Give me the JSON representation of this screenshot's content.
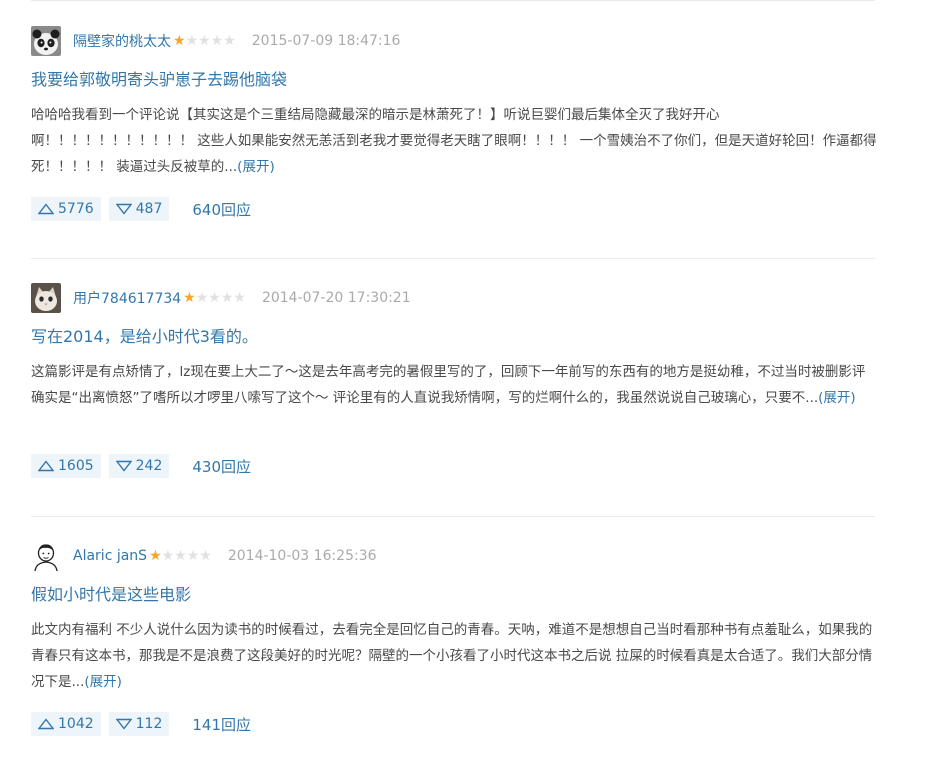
{
  "colors": {
    "link": "#3377aa",
    "text": "#494949",
    "muted": "#aaaaaa",
    "star_on": "#f6a623",
    "star_off": "#e1e1e1",
    "vote_bg": "#edf4fa"
  },
  "reviews": [
    {
      "author": "隔壁家的桃太太",
      "rating_stars": 1,
      "rating_max": 5,
      "time": "2015-07-09 18:47:16",
      "title": "我要给郭敬明寄头驴崽子去踢他脑袋",
      "excerpt": "哈哈哈我看到一个评论说【其实这是个三重结局隐藏最深的暗示是林萧死了！】听说巨婴们最后集体全灭了我好开心啊！！！！！！！！！！！ 这些人如果能安然无恙活到老我才要觉得老天瞎了眼啊！！！！ 一个雪姨治不了你们，但是天道好轮回！作逼都得死！！！！！ 装逼过头反被草的...",
      "expand_label": "(展开)",
      "up": "5776",
      "down": "487",
      "replies": "640回应",
      "avatar_icon": "panda-avatar-icon"
    },
    {
      "author": "用户784617734",
      "rating_stars": 1,
      "rating_max": 5,
      "time": "2014-07-20 17:30:21",
      "title": "写在2014，是给小时代3看的。",
      "excerpt": "这篇影评是有点矫情了，lz现在要上大二了～这是去年高考完的暑假里写的了，回顾下一年前写的东西有的地方是挺幼稚，不过当时被删影评确实是“出离愤怒”了嗜所以才啰里八嗦写了这个～ 评论里有的人直说我矫情啊，写的烂啊什么的，我虽然说说自己玻璃心，只要不...",
      "expand_label": "(展开)",
      "up": "1605",
      "down": "242",
      "replies": "430回应",
      "avatar_icon": "cat-avatar-icon"
    },
    {
      "author": "Alaric janS",
      "rating_stars": 1,
      "rating_max": 5,
      "time": "2014-10-03 16:25:36",
      "title": "假如小时代是这些电影",
      "excerpt": "此文内有福利 不少人说什么因为读书的时候看过，去看完全是回忆自己的青春。天呐，难道不是想想自己当时看那种书有点羞耻么，如果我的青春只有这本书，那我是不是浪费了这段美好的时光呢？隔壁的一个小孩看了小时代这本书之后说 拉屎的时候看真是太合适了。我们大部分情况下是...",
      "expand_label": "(展开)",
      "up": "1042",
      "down": "112",
      "replies": "141回应",
      "avatar_icon": "sketch-person-avatar-icon"
    }
  ]
}
